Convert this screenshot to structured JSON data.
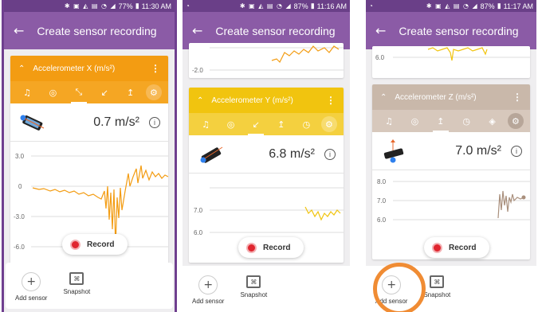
{
  "appbar": {
    "back_icon": "arrow-left-icon",
    "title": "Create sensor recording"
  },
  "phones": [
    {
      "status": {
        "battery": "77%",
        "time": "11:30 AM"
      },
      "card": {
        "title": "Accelerometer X (m/s²)",
        "color": "#f39c12",
        "reading": "0.7 m/s²",
        "ticks": [
          "3.0",
          "0",
          "-3.0",
          "-6.0"
        ]
      }
    },
    {
      "status": {
        "battery": "87%",
        "time": "11:16 AM"
      },
      "top_tick": "-2.0",
      "card": {
        "title": "Accelerometer Y (m/s²)",
        "color": "#f1c40f",
        "reading": "6.8 m/s²",
        "ticks": [
          "7.0",
          "6.0"
        ]
      }
    },
    {
      "status": {
        "battery": "87%",
        "time": "11:17 AM"
      },
      "top_tick": "6.0",
      "card": {
        "title": "Accelerometer Z (m/s²)",
        "color": "#c9b8aa",
        "reading": "7.0 m/s²",
        "ticks": [
          "8.0",
          "7.0",
          "6.0"
        ]
      }
    }
  ],
  "record_label": "Record",
  "add_sensor_label": "Add sensor",
  "snapshot_label": "Snapshot",
  "accent_purple": "#8b5ba6",
  "highlight_color": "#f08c34"
}
